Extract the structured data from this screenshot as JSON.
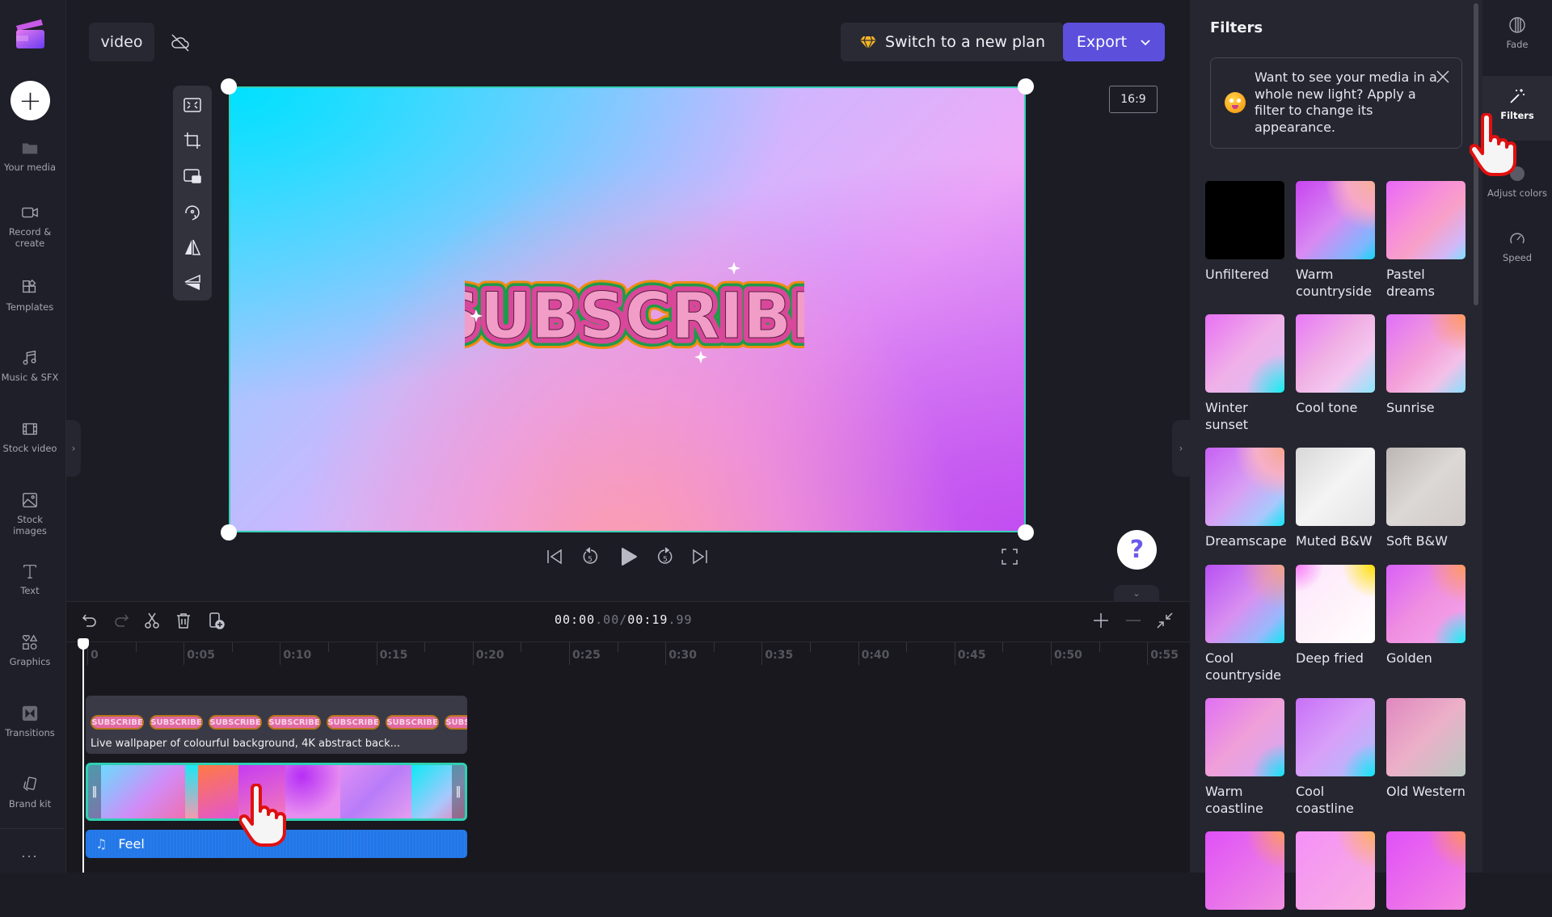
{
  "app": {
    "project_name": "video",
    "cloud_status_icon": "cloud-off-icon"
  },
  "sidebar": {
    "add_icon": "plus-icon",
    "items": [
      {
        "label": "Your media",
        "icon": "folder-icon"
      },
      {
        "label": "Record &\ncreate",
        "icon": "camera-icon"
      },
      {
        "label": "Templates",
        "icon": "templates-icon"
      },
      {
        "label": "Music & SFX",
        "icon": "music-icon"
      },
      {
        "label": "Stock video",
        "icon": "film-icon"
      },
      {
        "label": "Stock images",
        "icon": "image-icon"
      },
      {
        "label": "Text",
        "icon": "text-icon"
      },
      {
        "label": "Graphics",
        "icon": "shapes-icon"
      },
      {
        "label": "Transitions",
        "icon": "transitions-icon"
      },
      {
        "label": "Brand kit",
        "icon": "brand-kit-icon"
      }
    ],
    "more_label": "..."
  },
  "header": {
    "plan_button": "Switch to a new plan",
    "plan_icon": "diamond-icon",
    "export_button": "Export",
    "aspect_ratio": "16:9"
  },
  "tools": [
    {
      "name": "fit-icon"
    },
    {
      "name": "crop-icon"
    },
    {
      "name": "picture-in-picture-icon"
    },
    {
      "name": "rotate-icon"
    },
    {
      "name": "flip-horizontal-icon"
    },
    {
      "name": "flip-vertical-icon"
    }
  ],
  "preview": {
    "sticker_text": "SUBSCRIBE"
  },
  "playback": {
    "skip_back_label": "5",
    "skip_forward_label": "5",
    "help_label": "?",
    "current_time_main": "00:00",
    "current_time_frac": ".00",
    "separator": "/",
    "total_time_main": "00:19",
    "total_time_frac": ".99"
  },
  "timeline": {
    "ruler": [
      "0",
      "0:05",
      "0:10",
      "0:15",
      "0:20",
      "0:25",
      "0:30",
      "0:35",
      "0:40",
      "0:45",
      "0:50",
      "0:55"
    ],
    "sticker_track": {
      "mini_label": "SUBSCRIBE",
      "label": "Live wallpaper of colourful background, 4K abstract back..."
    },
    "audio_track": {
      "label": "Feel",
      "icon": "music-note-icon"
    }
  },
  "filters_panel": {
    "title": "Filters",
    "tip": "Want to see your media in a whole new light? Apply a filter to change its appearance.",
    "filters": [
      {
        "name": "Unfiltered"
      },
      {
        "name": "Warm countryside"
      },
      {
        "name": "Pastel dreams"
      },
      {
        "name": "Winter sunset"
      },
      {
        "name": "Cool tone"
      },
      {
        "name": "Sunrise"
      },
      {
        "name": "Dreamscape"
      },
      {
        "name": "Muted B&W"
      },
      {
        "name": "Soft B&W"
      },
      {
        "name": "Cool countryside"
      },
      {
        "name": "Deep fried"
      },
      {
        "name": "Golden"
      },
      {
        "name": "Warm coastline"
      },
      {
        "name": "Cool coastline"
      },
      {
        "name": "Old Western"
      },
      {
        "name": ""
      },
      {
        "name": ""
      },
      {
        "name": ""
      }
    ]
  },
  "right_rail": {
    "items": [
      {
        "label": "Fade",
        "icon": "fade-icon",
        "active": false
      },
      {
        "label": "Filters",
        "icon": "magic-wand-icon",
        "active": true
      },
      {
        "label": "Adjust colors",
        "icon": "adjust-colors-icon",
        "active": false
      },
      {
        "label": "Speed",
        "icon": "speedometer-icon",
        "active": false
      }
    ]
  },
  "colors": {
    "accent": "#5b4fdb",
    "selection": "#35d1b7",
    "audio_track": "#2277e8"
  }
}
